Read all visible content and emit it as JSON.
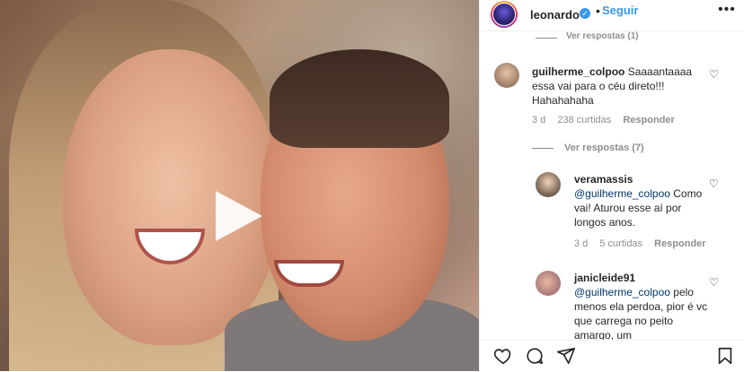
{
  "header": {
    "username": "leonardo",
    "follow_label": "Seguir",
    "dot": "•",
    "more": "•••"
  },
  "comments": {
    "cut_reply": "Ver respostas (1)",
    "main": {
      "user": "guilherme_colpoo",
      "text": "Saaaantaaaa essa vai para o céu direto!!! Hahahahaha",
      "time": "3 d",
      "likes": "238 curtidas",
      "reply": "Responder",
      "view_replies": "Ver respostas (7)"
    },
    "replies": [
      {
        "user": "veramassis",
        "mention": "@guilherme_colpoo",
        "text": "Como vai! Aturou esse aí por longos anos.",
        "time": "3 d",
        "likes": "5 curtidas",
        "reply": "Responder"
      },
      {
        "user": "janicleide91",
        "mention": "@guilherme_colpoo",
        "text": "pelo menos ela perdoa, pior é vc que carrega no peito amargo, um"
      }
    ]
  },
  "icons": {
    "heart": "♡",
    "verified": "✓"
  }
}
